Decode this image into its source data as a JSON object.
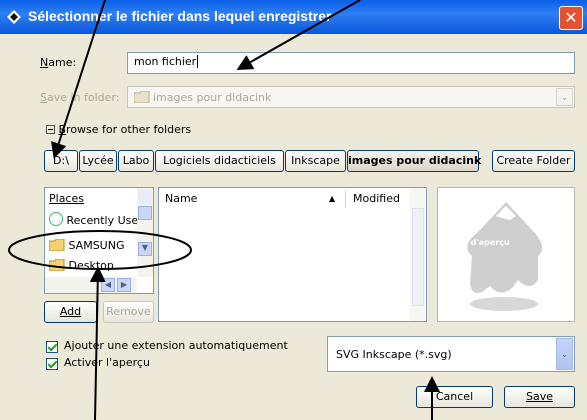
{
  "window": {
    "title": "Sélectionner le fichier dans lequel enregistrer"
  },
  "name_row": {
    "label_u": "N",
    "label_rest": "ame:",
    "value": "mon fichier"
  },
  "save_folder": {
    "label_u": "S",
    "label_rest": "ave in folder:",
    "value": "images pour didacink"
  },
  "browse": {
    "label_u": "B",
    "label_rest": "rowse for other folders"
  },
  "breadcrumbs": [
    "D:\\",
    "Lycée",
    "Labo",
    "Logiciels didacticiels",
    "Inkscape",
    "images pour didacink"
  ],
  "create_folder": "Create Folder",
  "places": {
    "header": "Places",
    "items": [
      {
        "label": "Recently Used",
        "icon": "recent-icon"
      },
      {
        "label": "SAMSUNG",
        "icon": "folder-icon"
      },
      {
        "label": "Desktop",
        "icon": "folder-icon"
      }
    ]
  },
  "files": {
    "col_name": "Name",
    "col_modified": "Modified"
  },
  "preview": {
    "text": "Pas d'aperçu"
  },
  "add_button": "Add",
  "remove_button": "Remove",
  "options": {
    "auto_ext": "Ajouter une extension automatiquement",
    "preview": "Activer l'aperçu"
  },
  "filetype": {
    "value": "SVG Inkscape (*.svg)"
  },
  "cancel_button": "Cancel",
  "save_button": "Save",
  "colors": {
    "title_bar": "#0a5fe8",
    "close": "#e3512d",
    "panel_border": "#7f9db9"
  }
}
